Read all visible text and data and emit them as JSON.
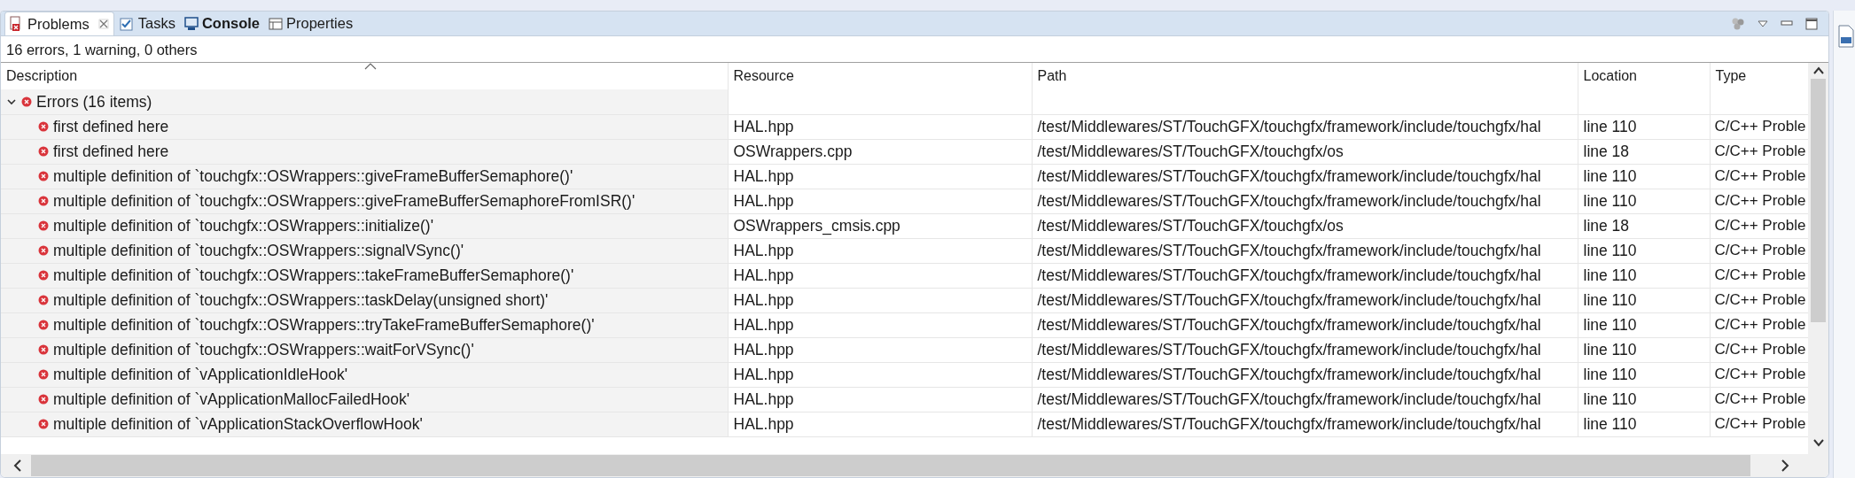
{
  "tabs": [
    {
      "label": "Problems",
      "selected": true,
      "closable": true,
      "bold": false
    },
    {
      "label": "Tasks",
      "selected": false,
      "closable": false,
      "bold": false
    },
    {
      "label": "Console",
      "selected": false,
      "closable": false,
      "bold": true
    },
    {
      "label": "Properties",
      "selected": false,
      "closable": false,
      "bold": false
    }
  ],
  "summary": "16 errors, 1 warning, 0 others",
  "table": {
    "columns": [
      {
        "label": "Description",
        "sorted": true
      },
      {
        "label": "Resource",
        "sorted": false
      },
      {
        "label": "Path",
        "sorted": false
      },
      {
        "label": "Location",
        "sorted": false
      },
      {
        "label": "Type",
        "sorted": false
      }
    ],
    "groups": [
      {
        "label": "Errors (16 items)",
        "expanded": true,
        "children": [
          {
            "description": "first defined here",
            "resource": "HAL.hpp",
            "path": "/test/Middlewares/ST/TouchGFX/touchgfx/framework/include/touchgfx/hal",
            "location": "line 110",
            "type": "C/C++ Proble"
          },
          {
            "description": "first defined here",
            "resource": "OSWrappers.cpp",
            "path": "/test/Middlewares/ST/TouchGFX/touchgfx/os",
            "location": "line 18",
            "type": "C/C++ Proble"
          },
          {
            "description": "multiple definition of `touchgfx::OSWrappers::giveFrameBufferSemaphore()'",
            "resource": "HAL.hpp",
            "path": "/test/Middlewares/ST/TouchGFX/touchgfx/framework/include/touchgfx/hal",
            "location": "line 110",
            "type": "C/C++ Proble"
          },
          {
            "description": "multiple definition of `touchgfx::OSWrappers::giveFrameBufferSemaphoreFromISR()'",
            "resource": "HAL.hpp",
            "path": "/test/Middlewares/ST/TouchGFX/touchgfx/framework/include/touchgfx/hal",
            "location": "line 110",
            "type": "C/C++ Proble"
          },
          {
            "description": "multiple definition of `touchgfx::OSWrappers::initialize()'",
            "resource": "OSWrappers_cmsis.cpp",
            "path": "/test/Middlewares/ST/TouchGFX/touchgfx/os",
            "location": "line 18",
            "type": "C/C++ Proble"
          },
          {
            "description": "multiple definition of `touchgfx::OSWrappers::signalVSync()'",
            "resource": "HAL.hpp",
            "path": "/test/Middlewares/ST/TouchGFX/touchgfx/framework/include/touchgfx/hal",
            "location": "line 110",
            "type": "C/C++ Proble"
          },
          {
            "description": "multiple definition of `touchgfx::OSWrappers::takeFrameBufferSemaphore()'",
            "resource": "HAL.hpp",
            "path": "/test/Middlewares/ST/TouchGFX/touchgfx/framework/include/touchgfx/hal",
            "location": "line 110",
            "type": "C/C++ Proble"
          },
          {
            "description": "multiple definition of `touchgfx::OSWrappers::taskDelay(unsigned short)'",
            "resource": "HAL.hpp",
            "path": "/test/Middlewares/ST/TouchGFX/touchgfx/framework/include/touchgfx/hal",
            "location": "line 110",
            "type": "C/C++ Proble"
          },
          {
            "description": "multiple definition of `touchgfx::OSWrappers::tryTakeFrameBufferSemaphore()'",
            "resource": "HAL.hpp",
            "path": "/test/Middlewares/ST/TouchGFX/touchgfx/framework/include/touchgfx/hal",
            "location": "line 110",
            "type": "C/C++ Proble"
          },
          {
            "description": "multiple definition of `touchgfx::OSWrappers::waitForVSync()'",
            "resource": "HAL.hpp",
            "path": "/test/Middlewares/ST/TouchGFX/touchgfx/framework/include/touchgfx/hal",
            "location": "line 110",
            "type": "C/C++ Proble"
          },
          {
            "description": "multiple definition of `vApplicationIdleHook'",
            "resource": "HAL.hpp",
            "path": "/test/Middlewares/ST/TouchGFX/touchgfx/framework/include/touchgfx/hal",
            "location": "line 110",
            "type": "C/C++ Proble"
          },
          {
            "description": "multiple definition of `vApplicationMallocFailedHook'",
            "resource": "HAL.hpp",
            "path": "/test/Middlewares/ST/TouchGFX/touchgfx/framework/include/touchgfx/hal",
            "location": "line 110",
            "type": "C/C++ Proble"
          },
          {
            "description": "multiple definition of `vApplicationStackOverflowHook'",
            "resource": "HAL.hpp",
            "path": "/test/Middlewares/ST/TouchGFX/touchgfx/framework/include/touchgfx/hal",
            "location": "line 110",
            "type": "C/C++ Proble"
          }
        ]
      }
    ]
  }
}
